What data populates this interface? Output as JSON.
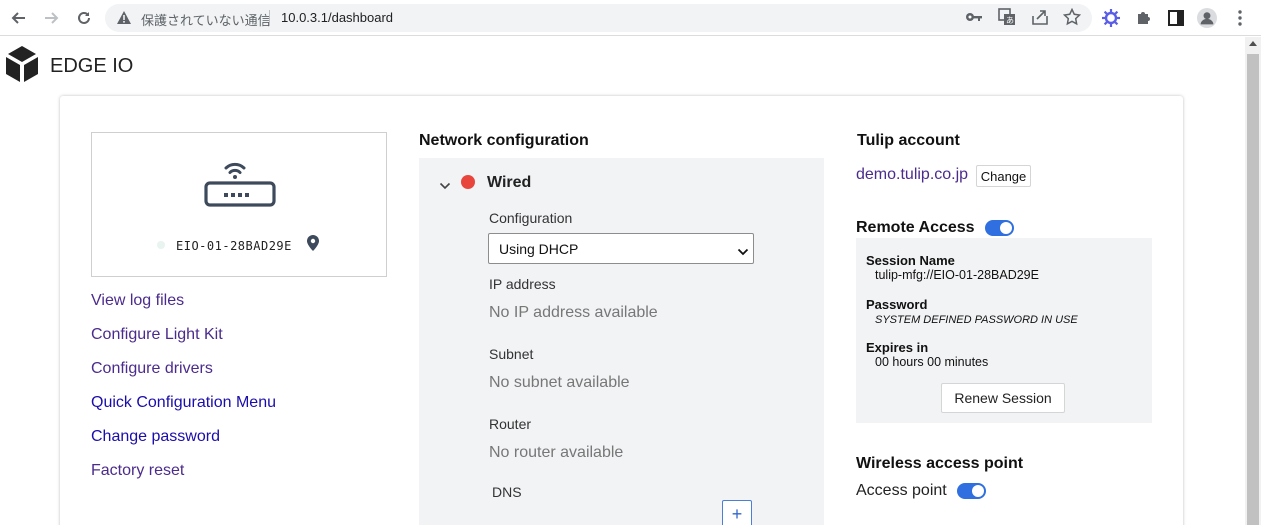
{
  "browser": {
    "insecure_label": "保護されていない通信",
    "url": "10.0.3.1/dashboard"
  },
  "header": {
    "brand": "EDGE IO"
  },
  "device": {
    "name": "EIO-01-28BAD29E"
  },
  "sidebar": {
    "links": [
      {
        "label": "View log files"
      },
      {
        "label": "Configure Light Kit"
      },
      {
        "label": "Configure drivers"
      },
      {
        "label": "Quick Configuration Menu"
      },
      {
        "label": "Change password"
      },
      {
        "label": "Factory reset"
      }
    ]
  },
  "network": {
    "title": "Network configuration",
    "interface": "Wired",
    "status_color": "#e8453c",
    "configuration_label": "Configuration",
    "configuration_value": "Using DHCP",
    "ip_label": "IP address",
    "ip_value": "No IP address available",
    "subnet_label": "Subnet",
    "subnet_value": "No subnet available",
    "router_label": "Router",
    "router_value": "No router available",
    "dns_label": "DNS",
    "add_label": "+"
  },
  "account": {
    "title": "Tulip account",
    "domain": "demo.tulip.co.jp",
    "change_label": "Change"
  },
  "remote": {
    "title": "Remote Access",
    "enabled": true,
    "session_name_label": "Session Name",
    "session_name_value": "tulip-mfg://EIO-01-28BAD29E",
    "password_label": "Password",
    "password_value": "SYSTEM DEFINED PASSWORD IN USE",
    "expires_label": "Expires in",
    "expires_value": "00 hours 00 minutes",
    "renew_label": "Renew Session"
  },
  "wireless": {
    "title": "Wireless access point",
    "access_point_label": "Access point",
    "enabled": true
  },
  "colors": {
    "accent": "#2f6fe0",
    "link": "#4b2b8c"
  }
}
